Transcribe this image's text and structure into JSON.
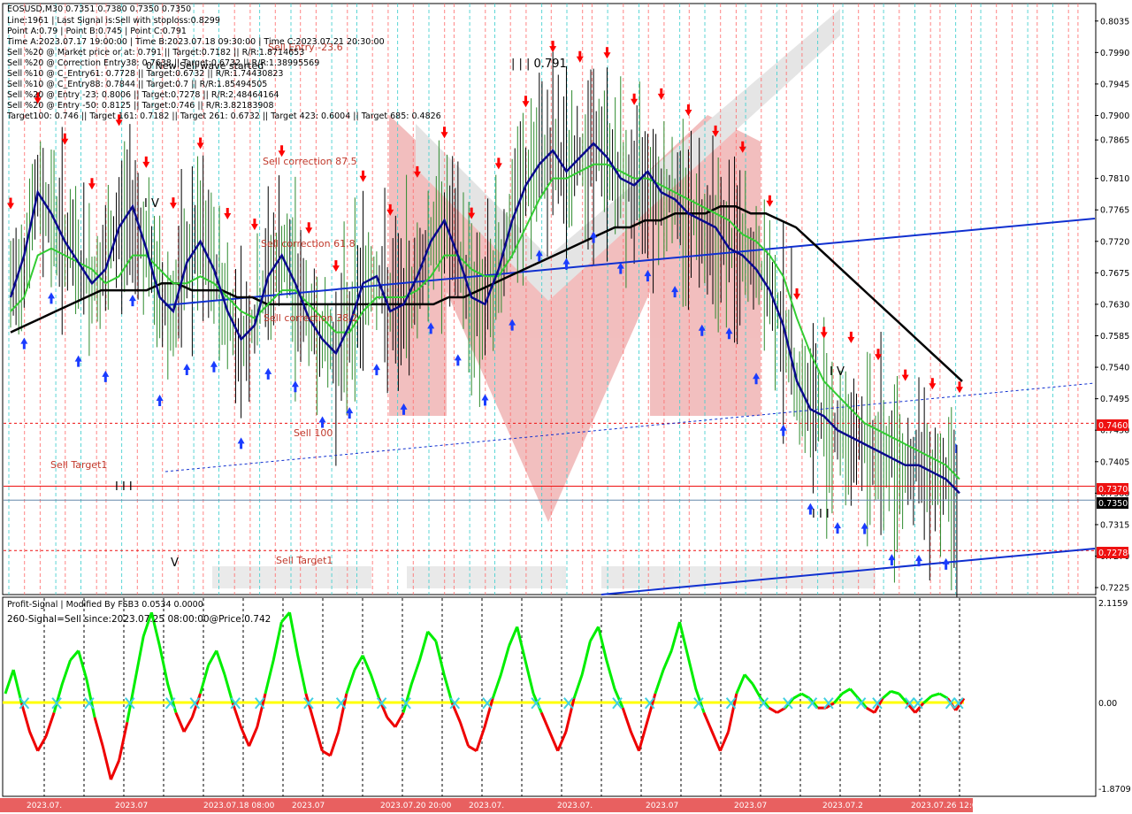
{
  "header": {
    "symbol_line": "EOSUSD,M30  0.7351 0.7380 0.7350 0.7350",
    "info_lines": [
      "Line:1961 | Last Signal is:Sell with stoploss:0.8299",
      "Point A:0.79 | Point B:0.745 | Point C:0.791",
      "Time A:2023.07.17 19:00:00 | Time B:2023.07.18 09:30:00 | Time C:2023.07.21 20:30:00",
      "Sell %20 @ Market price or at: 0.791 || Target:0.7182 || R/R:1.8714653",
      "Sell %20 @ Correction Entry38: 0.7638 || Target:0.6732 || R/R:1.38995569",
      "Sell %10 @ C_Entry61: 0.7728 || Target:0.6732 || R/R:1.74430823",
      "Sell %10 @ C_Entry88: 0.7844 || Target:0.7 || R/R:1.85494505",
      "Sell %20 @ Entry -23: 0.8006 || Target:0.7278 || R/R:2.48464164",
      "Sell %20 @ Entry -50: 0.8125 || Target:0.746 || R/R:3.82183908",
      "Target100: 0.746 || Target 161: 0.7182 || Target 261: 0.6732 || Target 423: 0.6004 || Target 685: 0.4826"
    ],
    "overlap_text": "0 New Sell wave started"
  },
  "annotations": {
    "sell_entry": "Sell Entry -23.6",
    "sell_correction_875": "Sell correction 87.5",
    "sell_correction_618": "Sell correction 61.8",
    "sell_correction_382": "Sell correction 38.2",
    "sell_100": "Sell 100",
    "sell_target_1a": "Sell Target1",
    "sell_target_1b": "Sell Target1",
    "wave_c_label": "| | | 0.791",
    "wave_iv_a": "I V",
    "wave_iii_a": "I I I",
    "wave_v": "V",
    "wave_iv_b": "I V",
    "wave_iii_b": "I I I",
    "wave_i": "I"
  },
  "price_tags": {
    "t1": "0.7460",
    "t2": "0.7370",
    "current": "0.7350",
    "t3": "0.7278"
  },
  "indicator": {
    "title": "Profit-Signal | Modified By FSB3 0.0534 0.0000",
    "signal": "260-Signal=Sell since:2023.07.25 08:00:00@Price:0.742"
  },
  "colors": {
    "sell_red": "#ff0000",
    "buy_blue": "#1a3cff",
    "ma_black": "#000000",
    "ma_navy": "#0a0a8c",
    "ma_green": "#33cc33",
    "trend_blue": "#1030d0",
    "osc_green": "#00ee00",
    "osc_red": "#ee0000",
    "osc_zero": "#ffff00",
    "tag_red": "#ee1111",
    "tag_dark": "#000000"
  },
  "chart_data": {
    "type": "line",
    "symbol": "EOSUSD",
    "timeframe": "M30",
    "ohlc_last": {
      "open": 0.7351,
      "high": 0.738,
      "low": 0.735,
      "close": 0.735
    },
    "price_axis": {
      "ticks": [
        "0.8035",
        "0.7990",
        "0.7945",
        "0.7900",
        "0.7865",
        "0.7810",
        "0.7765",
        "0.7720",
        "0.7675",
        "0.7630",
        "0.7585",
        "0.7540",
        "0.7495",
        "0.7450",
        "0.7405",
        "0.7360",
        "0.7315",
        "0.7270",
        "0.7225"
      ],
      "ylim": [
        0.7215,
        0.806
      ]
    },
    "oscillator_axis": {
      "ticks": [
        "2.1159",
        "0.00",
        "-1.8709"
      ],
      "ylim": [
        -1.95,
        2.2
      ]
    },
    "horizontal_levels": [
      {
        "label": "Sell 100",
        "value": 0.746
      },
      {
        "label": "Sell Target1",
        "value": 0.737
      },
      {
        "label": "current",
        "value": 0.735
      },
      {
        "label": "Sell Target1",
        "value": 0.7278
      }
    ],
    "time_labels": [
      "2023.07.",
      "2023.07",
      "2023.07.18 08:00",
      "2023.07",
      "2023.07.20 20:00",
      "2023.07.",
      "2023.07.",
      "2023.07",
      "2023.07",
      "2023.07.2",
      "2023.07.26 12:00"
    ],
    "series": [
      {
        "name": "",
        "values": [
          0.764,
          0.77,
          0.779,
          0.776,
          0.772,
          0.769,
          0.766,
          0.768,
          0.774,
          0.777,
          0.771,
          0.764,
          0.762,
          0.769,
          0.772,
          0.768,
          0.762,
          0.758,
          0.76,
          0.767,
          0.77,
          0.766,
          0.761,
          0.758,
          0.756,
          0.76,
          0.766,
          0.767,
          0.762,
          0.763,
          0.767,
          0.772,
          0.775,
          0.77,
          0.764,
          0.763,
          0.768,
          0.775,
          0.78,
          0.783,
          0.785,
          0.782,
          0.784,
          0.786,
          0.784,
          0.781,
          0.78,
          0.782,
          0.779,
          0.778,
          0.776,
          0.775,
          0.774,
          0.771,
          0.77,
          0.768,
          0.765,
          0.76,
          0.752,
          0.748,
          0.747,
          0.745,
          0.744,
          0.743,
          0.742,
          0.741,
          0.74,
          0.74,
          0.739,
          0.738,
          0.736
        ]
      },
      {
        "name": "",
        "values": [
          0.762,
          0.764,
          0.77,
          0.771,
          0.77,
          0.769,
          0.768,
          0.766,
          0.767,
          0.77,
          0.77,
          0.768,
          0.766,
          0.766,
          0.767,
          0.766,
          0.764,
          0.762,
          0.761,
          0.763,
          0.765,
          0.765,
          0.763,
          0.761,
          0.759,
          0.759,
          0.762,
          0.764,
          0.764,
          0.764,
          0.765,
          0.767,
          0.77,
          0.77,
          0.768,
          0.767,
          0.767,
          0.77,
          0.774,
          0.778,
          0.781,
          0.781,
          0.782,
          0.783,
          0.783,
          0.782,
          0.781,
          0.781,
          0.78,
          0.779,
          0.778,
          0.777,
          0.776,
          0.775,
          0.773,
          0.772,
          0.77,
          0.767,
          0.761,
          0.756,
          0.752,
          0.75,
          0.748,
          0.746,
          0.745,
          0.744,
          0.743,
          0.742,
          0.741,
          0.74,
          0.738
        ]
      },
      {
        "name": "",
        "values": [
          0.759,
          0.76,
          0.761,
          0.762,
          0.763,
          0.764,
          0.765,
          0.765,
          0.765,
          0.765,
          0.766,
          0.766,
          0.765,
          0.765,
          0.765,
          0.764,
          0.764,
          0.763,
          0.763,
          0.763,
          0.763,
          0.763,
          0.763,
          0.763,
          0.763,
          0.763,
          0.763,
          0.763,
          0.763,
          0.764,
          0.764,
          0.765,
          0.766,
          0.767,
          0.768,
          0.769,
          0.77,
          0.771,
          0.772,
          0.773,
          0.774,
          0.774,
          0.775,
          0.775,
          0.776,
          0.776,
          0.776,
          0.777,
          0.777,
          0.776,
          0.776,
          0.775,
          0.774,
          0.772,
          0.77,
          0.768,
          0.766,
          0.764,
          0.762,
          0.76,
          0.758,
          0.756,
          0.754,
          0.752
        ]
      },
      {
        "name": "",
        "values": [
          0.2,
          0.7,
          0.0,
          -0.6,
          -1.0,
          -0.7,
          -0.2,
          0.4,
          0.9,
          1.1,
          0.5,
          -0.3,
          -0.9,
          -1.6,
          -1.2,
          -0.4,
          0.5,
          1.4,
          1.9,
          1.2,
          0.4,
          -0.2,
          -0.6,
          -0.3,
          0.2,
          0.8,
          1.1,
          0.6,
          0.0,
          -0.5,
          -0.9,
          -0.5,
          0.2,
          0.9,
          1.7,
          1.9,
          1.0,
          0.2,
          -0.4,
          -1.0,
          -1.1,
          -0.6,
          0.2,
          0.7,
          1.0,
          0.6,
          0.1,
          -0.3,
          -0.5,
          -0.2,
          0.4,
          0.9,
          1.5,
          1.3,
          0.6,
          0.0,
          -0.4,
          -0.9,
          -1.0,
          -0.5,
          0.1,
          0.6,
          1.2,
          1.6,
          0.9,
          0.2,
          -0.2,
          -0.6,
          -1.0,
          -0.6,
          0.1,
          0.6,
          1.3,
          1.6,
          0.9,
          0.3,
          -0.1,
          -0.6,
          -1.0,
          -0.4,
          0.2,
          0.7,
          1.1,
          1.7,
          1.0,
          0.3,
          -0.2,
          -0.6,
          -1.0,
          -0.6,
          0.2,
          0.6,
          0.4,
          0.1,
          -0.1,
          -0.2,
          -0.1,
          0.1,
          0.2,
          0.1,
          -0.1,
          -0.1,
          0.0,
          0.2,
          0.3,
          0.1,
          -0.1,
          -0.2,
          0.1,
          0.25,
          0.2,
          0.0,
          -0.2,
          0.0,
          0.15,
          0.2,
          0.1,
          -0.15,
          0.1
        ]
      }
    ]
  }
}
